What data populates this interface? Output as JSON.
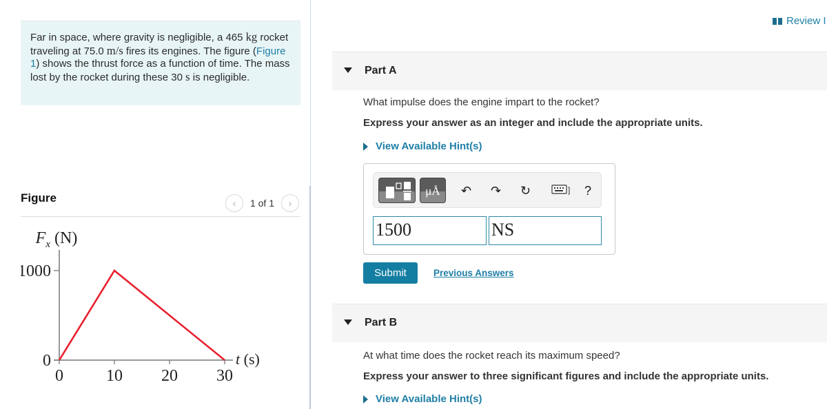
{
  "problem": {
    "text_1": "Far in space, where gravity is negligible, a 465 ",
    "mass_unit": "kg",
    "text_2": " rocket traveling at 75.0 ",
    "speed_unit": "m/s",
    "text_3": " fires its engines. The figure (",
    "figure_link": "Figure 1",
    "text_4": ") shows the thrust force as a function of time. The mass lost by the rocket during these 30 ",
    "time_unit": "s",
    "text_5": " is negligible."
  },
  "figure": {
    "title": "Figure",
    "pager_text": "1 of 1",
    "prev_icon": "chevron-left-icon",
    "next_icon": "chevron-right-icon"
  },
  "chart_data": {
    "type": "line",
    "title": "",
    "ylabel_main": "F",
    "ylabel_sub": "x",
    "ylabel_unit": " (N)",
    "xlabel_main": "t",
    "xlabel_unit": " (s)",
    "x_ticks": [
      "0",
      "10",
      "20",
      "30"
    ],
    "y_ticks": [
      "0",
      "1000"
    ],
    "xlim": [
      0,
      30
    ],
    "ylim": [
      0,
      1000
    ],
    "grid": false,
    "series": [
      {
        "name": "Thrust force",
        "color": "#e8202f",
        "x": [
          0,
          10,
          30
        ],
        "y": [
          0,
          1000,
          0
        ]
      }
    ]
  },
  "header": {
    "review_label": "Review I",
    "review_icon": "book-icon"
  },
  "part_a": {
    "label": "Part A",
    "question": "What impulse does the engine impart to the rocket?",
    "instruction": "Express your answer as an integer and include the appropriate units.",
    "hint_label": "View Available Hint(s)",
    "toolbar": {
      "templates_icon": "templates-icon",
      "units_label": "μÅ",
      "undo_icon": "undo-icon",
      "redo_icon": "redo-icon",
      "reset_icon": "reset-icon",
      "keyboard_icon": "keyboard-icon",
      "help_label": "?"
    },
    "value": "1500",
    "units": "NS",
    "submit_label": "Submit",
    "previous_answers_label": "Previous Answers"
  },
  "part_b": {
    "label": "Part B",
    "question": "At what time does the rocket reach its maximum speed?",
    "instruction": "Express your answer to three significant figures and include the appropriate units.",
    "hint_label": "View Available Hint(s)"
  }
}
